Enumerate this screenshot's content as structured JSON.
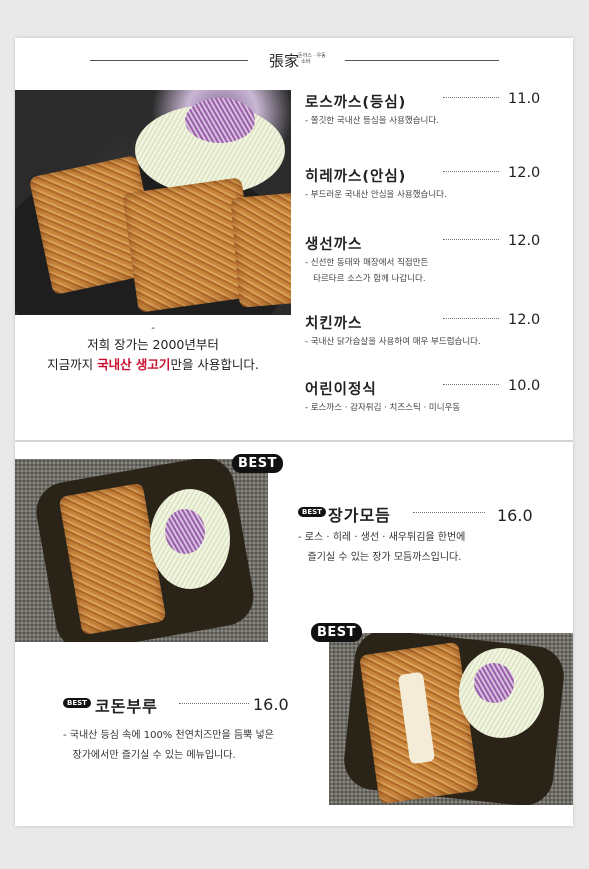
{
  "header": {
    "brand": "張家",
    "brand_sub": "돈까스 · 우동 · 소바"
  },
  "intro": {
    "line1": "저희 장가는 2000년부터",
    "line2_pre": "지금까지 ",
    "line2_hl": "국내산 생고기",
    "line2_post": "만을 사용합니다.",
    "accent_color": "#c8102e"
  },
  "menu": [
    {
      "name": "로스까스(등심)",
      "price": "11.0",
      "desc": "- 쫄깃한 국내산 등심을 사용했습니다."
    },
    {
      "name": "히레까스(안심)",
      "price": "12.0",
      "desc": "- 부드러운 국내산 안심을 사용했습니다."
    },
    {
      "name": "생선까스",
      "price": "12.0",
      "desc": "- 신선한 동태와 매장에서 직접만든\n   타르타르 소스가 함께 나갑니다."
    },
    {
      "name": "치킨까스",
      "price": "12.0",
      "desc": "- 국내산 닭가슴살을 사용하여 매우 부드럽습니다."
    },
    {
      "name": "어린이정식",
      "price": "10.0",
      "desc": "- 로스까스 · 감자튀김 · 치즈스틱 · 미니우동"
    }
  ],
  "best_label": "BEST",
  "best": [
    {
      "name": "장가모듬",
      "price": "16.0",
      "desc": "- 로스 · 히레 · 생선 · 새우튀김을 한번에\n   즐기실 수 있는 장가 모듬까스입니다."
    },
    {
      "name": "코돈부루",
      "price": "16.0",
      "desc": "- 국내산 등심 속에 100% 천연치즈만을 듬뿍 넣은\n   장가에서만 즐기실 수 있는 메뉴입니다."
    }
  ]
}
